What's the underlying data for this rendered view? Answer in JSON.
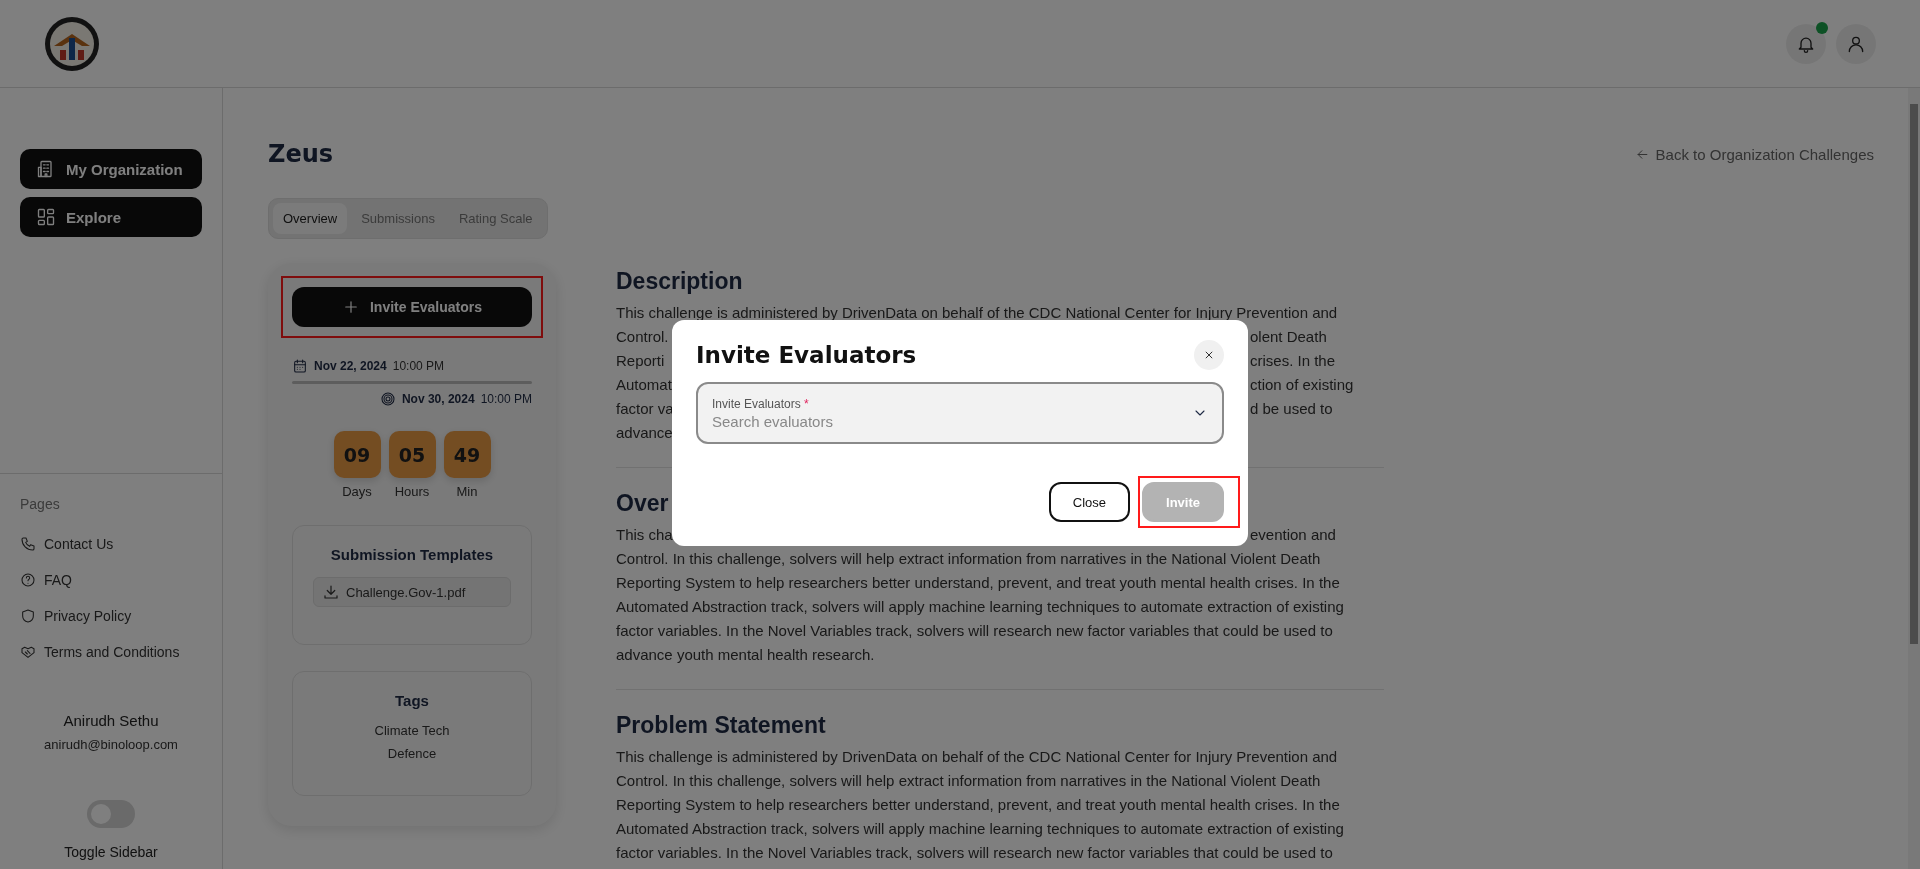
{
  "header": {
    "notifications": {
      "unread": true
    }
  },
  "sidebar": {
    "nav": [
      {
        "label": "My Organization",
        "kind": "building"
      },
      {
        "label": "Explore",
        "kind": "grid"
      }
    ],
    "pages_title": "Pages",
    "pages": [
      {
        "label": "Contact Us",
        "kind": "phone"
      },
      {
        "label": "FAQ",
        "kind": "help"
      },
      {
        "label": "Privacy Policy",
        "kind": "shield"
      },
      {
        "label": "Terms and Conditions",
        "kind": "handshake"
      }
    ],
    "user": {
      "name": "Anirudh Sethu",
      "email": "anirudh@binoloop.com"
    },
    "toggle": {
      "label": "Toggle Sidebar",
      "on": false
    }
  },
  "main": {
    "title": "Zeus",
    "back_link": "Back to Organization Challenges",
    "tabs": [
      {
        "label": "Overview",
        "selected": true
      },
      {
        "label": "Submissions",
        "selected": false
      },
      {
        "label": "Rating Scale",
        "selected": false
      }
    ],
    "card": {
      "invite_button": {
        "label": "Invite Evaluators",
        "highlighted": true
      },
      "start": {
        "date": "Nov 22, 2024",
        "time": "10:00 PM"
      },
      "end": {
        "date": "Nov 30, 2024",
        "time": "10:00 PM"
      },
      "countdown": [
        {
          "value": "09",
          "unit": "Days"
        },
        {
          "value": "05",
          "unit": "Hours"
        },
        {
          "value": "49",
          "unit": "Min"
        }
      ],
      "templates": {
        "title": "Submission Templates",
        "files": [
          "Challenge.Gov-1.pdf"
        ]
      },
      "tags": {
        "title": "Tags",
        "items": [
          "Climate Tech",
          "Defence"
        ]
      }
    },
    "sections": [
      {
        "heading": "Description",
        "lines": [
          {
            "left": "This challenge is administered by DrivenData on behalf of the CDC National Center for Injury Prevention and"
          },
          {
            "left": "Control.",
            "right": "olent Death"
          },
          {
            "left": "Reporti",
            "right": "crises. In the"
          },
          {
            "left": "Automat",
            "right": "ction of existing"
          },
          {
            "left": "factor va",
            "right": "d be used to"
          },
          {
            "left": "advance"
          }
        ]
      },
      {
        "heading": "Over",
        "lines": [
          {
            "left": "This cha",
            "right": "evention and"
          },
          {
            "left": "Control. In this challenge, solvers will help extract information from narratives in the National Violent Death"
          },
          {
            "left": "Reporting System to help researchers better understand, prevent, and treat youth mental health crises. In the"
          },
          {
            "left": "Automated Abstraction track, solvers will apply machine learning techniques to automate extraction of existing"
          },
          {
            "left": "factor variables. In the Novel Variables track, solvers will research new factor variables that could be used to"
          },
          {
            "left": "advance youth mental health research."
          }
        ]
      },
      {
        "heading": "Problem Statement",
        "body": "This challenge is administered by DrivenData on behalf of the CDC National Center for Injury Prevention and Control. In this challenge, solvers will help extract information from narratives in the National Violent Death Reporting System to help researchers better understand, prevent, and treat youth mental health crises. In the Automated Abstraction track, solvers will apply machine learning techniques to automate extraction of existing factor variables. In the Novel Variables track, solvers will research new factor variables that could be used to"
      }
    ]
  },
  "modal": {
    "title": "Invite Evaluators",
    "field": {
      "label": "Invite Evaluators",
      "required_mark": "*",
      "placeholder": "Search evaluators"
    },
    "buttons": [
      {
        "label": "Close",
        "kind": "outline",
        "disabled": false,
        "highlighted": false
      },
      {
        "label": "Invite",
        "kind": "primary",
        "disabled": true,
        "highlighted": true
      }
    ]
  }
}
